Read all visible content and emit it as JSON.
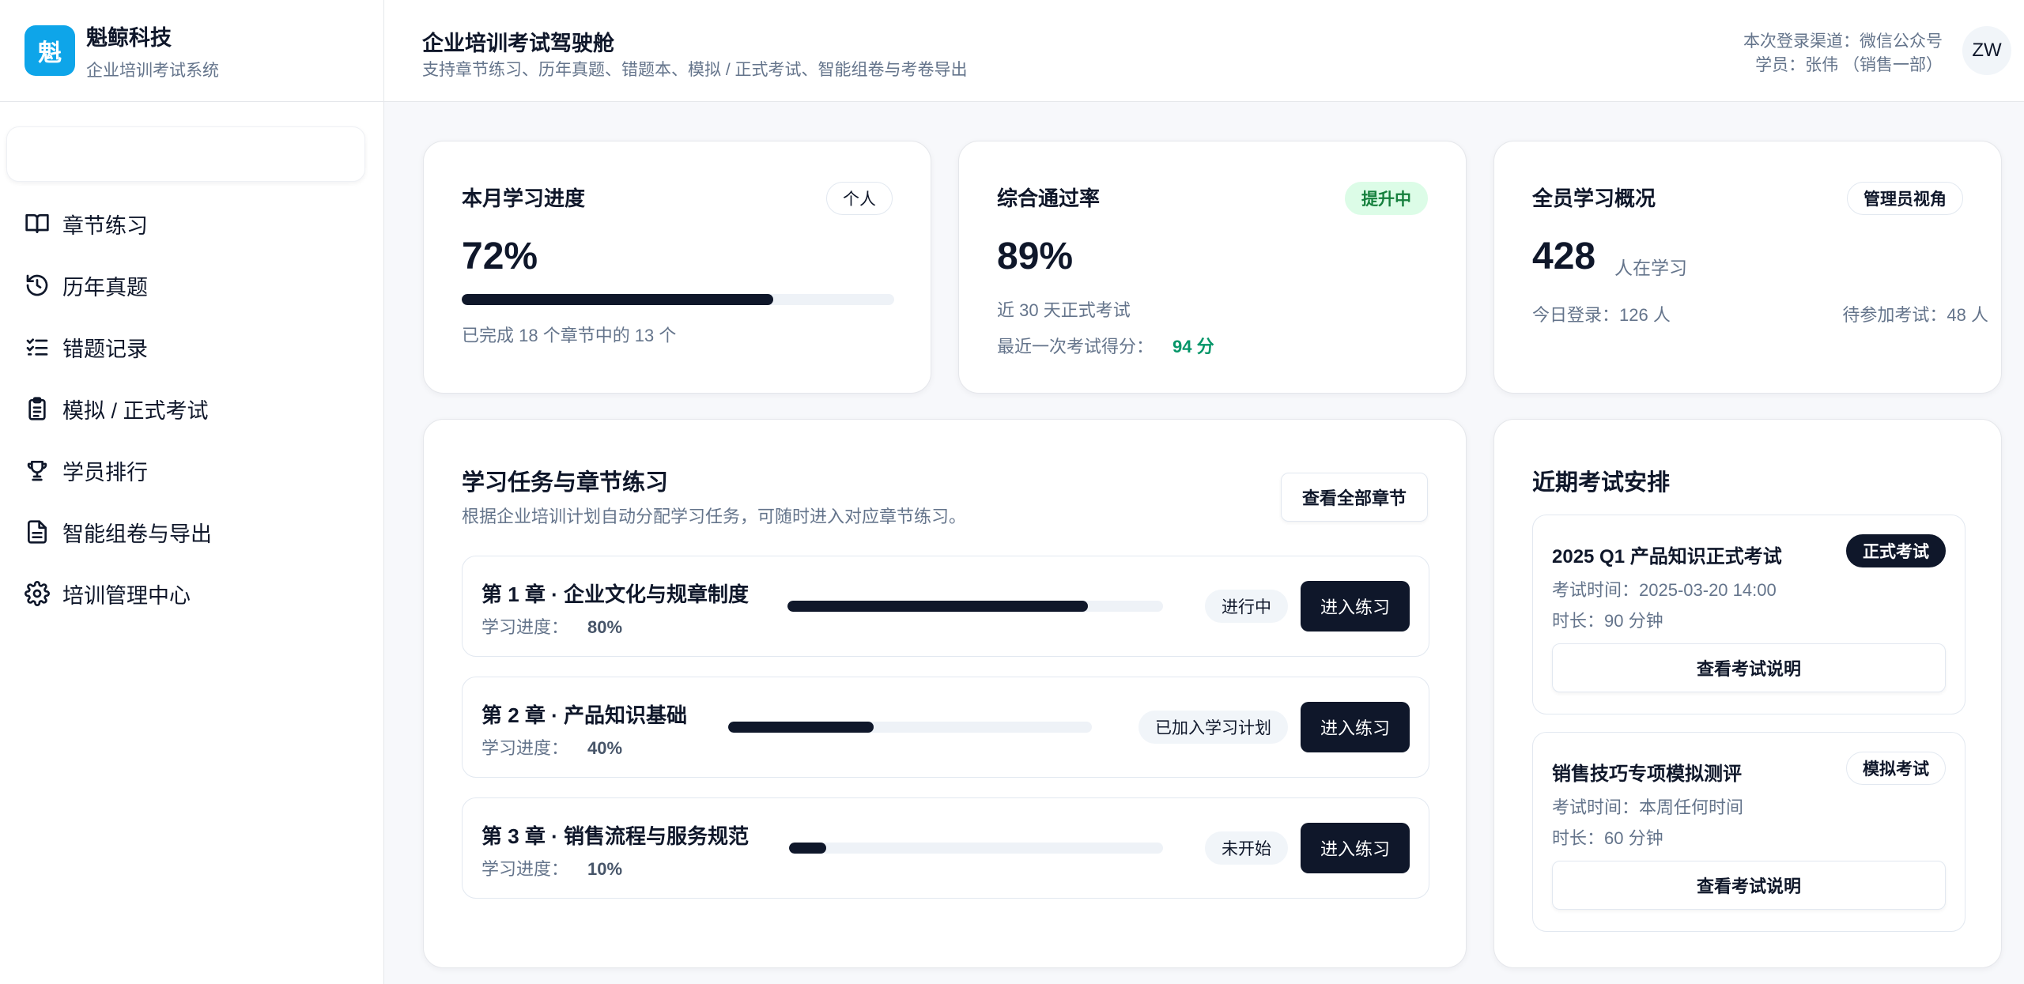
{
  "brand": {
    "logo": "魁",
    "name": "魁鲸科技",
    "subtitle": "企业培训考试系统"
  },
  "sidebar": {
    "items": [
      {
        "label": "章节练习",
        "icon": "book-open-icon"
      },
      {
        "label": "历年真题",
        "icon": "history-icon"
      },
      {
        "label": "错题记录",
        "icon": "checklist-icon"
      },
      {
        "label": "模拟 / 正式考试",
        "icon": "clipboard-icon"
      },
      {
        "label": "学员排行",
        "icon": "trophy-icon"
      },
      {
        "label": "智能组卷与导出",
        "icon": "document-icon"
      },
      {
        "label": "培训管理中心",
        "icon": "gear-icon"
      }
    ]
  },
  "header": {
    "title": "企业培训考试驾驶舱",
    "subtitle": "支持章节练习、历年真题、错题本、模拟 / 正式考试、智能组卷与考卷导出",
    "channel": "本次登录渠道：微信公众号",
    "user": "学员：张伟 （销售一部）",
    "avatar": "ZW"
  },
  "progress_card": {
    "title": "本月学习进度",
    "badge": "个人",
    "value": "72%",
    "percent": 72,
    "note": "已完成 18 个章节中的 13 个"
  },
  "pass_card": {
    "title": "综合通过率",
    "badge": "提升中",
    "value": "89%",
    "note": "近 30 天正式考试",
    "last_label": "最近一次考试得分：",
    "last_score": "94 分"
  },
  "overview_card": {
    "title": "全员学习概况",
    "badge": "管理员视角",
    "value": "428",
    "unit": "人在学习",
    "today": "今日登录：126 人",
    "pending": "待参加考试：48 人"
  },
  "tasks": {
    "title": "学习任务与章节练习",
    "subtitle": "根据企业培训计划自动分配学习任务，可随时进入对应章节练习。",
    "view_all": "查看全部章节",
    "progress_label": "学习进度：",
    "enter_label": "进入练习",
    "chapters": [
      {
        "name": "第 1 章 · 企业文化与规章制度",
        "progress": "80%",
        "percent": 80,
        "status": "进行中"
      },
      {
        "name": "第 2 章 · 产品知识基础",
        "progress": "40%",
        "percent": 40,
        "status": "已加入学习计划"
      },
      {
        "name": "第 3 章 · 销售流程与服务规范",
        "progress": "10%",
        "percent": 10,
        "status": "未开始"
      }
    ]
  },
  "exams": {
    "title": "近期考试安排",
    "detail_label": "查看考试说明",
    "items": [
      {
        "name": "2025 Q1 产品知识正式考试",
        "badge": "正式考试",
        "time": "考试时间：2025-03-20 14:00",
        "duration": "时长：90 分钟"
      },
      {
        "name": "销售技巧专项模拟测评",
        "badge": "模拟考试",
        "time": "考试时间：本周任何时间",
        "duration": "时长：60 分钟"
      }
    ]
  }
}
